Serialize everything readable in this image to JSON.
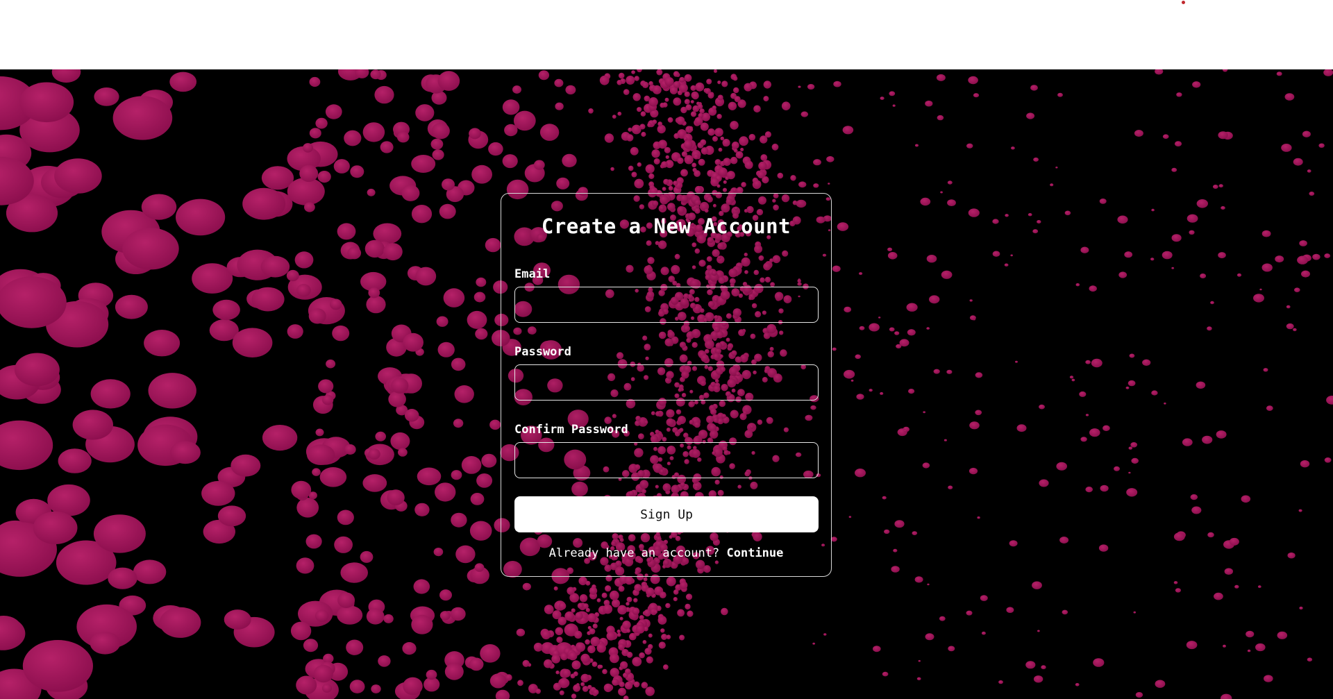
{
  "colors": {
    "particle": "#8b0e4d",
    "particle_highlight": "#b52168",
    "stage_background": "#000000",
    "accent_dot": "#c0282d"
  },
  "form": {
    "title": "Create a New Account",
    "email_label": "Email",
    "password_label": "Password",
    "confirm_password_label": "Confirm Password",
    "email_value": "",
    "password_value": "",
    "confirm_password_value": "",
    "submit_label": "Sign Up",
    "footer_prompt": "Already have an account?",
    "footer_link": "Continue"
  }
}
